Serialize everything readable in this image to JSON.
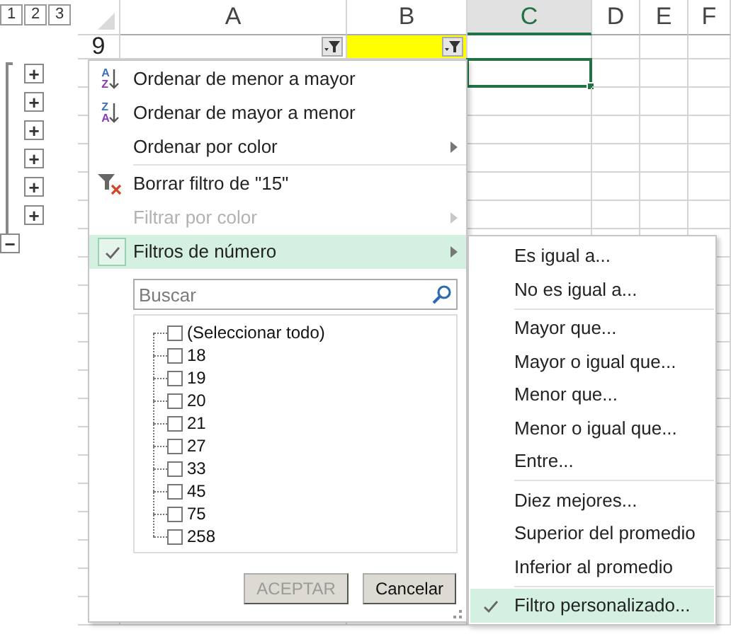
{
  "outline_levels": [
    "1",
    "2",
    "3"
  ],
  "columns": [
    {
      "label": "A",
      "selected": false
    },
    {
      "label": "B",
      "selected": false
    },
    {
      "label": "C",
      "selected": true
    },
    {
      "label": "D",
      "selected": false
    },
    {
      "label": "E",
      "selected": false
    },
    {
      "label": "F",
      "selected": false
    }
  ],
  "header_row": {
    "number": "9",
    "cells": [
      {
        "filter_button": true,
        "highlighted": false
      },
      {
        "filter_button": true,
        "highlighted": true
      }
    ]
  },
  "outline_buttons": [
    {
      "symbol": "+",
      "kind": "expand"
    },
    {
      "symbol": "+",
      "kind": "expand"
    },
    {
      "symbol": "+",
      "kind": "expand"
    },
    {
      "symbol": "+",
      "kind": "expand"
    },
    {
      "symbol": "+",
      "kind": "expand"
    },
    {
      "symbol": "+",
      "kind": "expand"
    },
    {
      "symbol": "−",
      "kind": "collapse"
    }
  ],
  "filter_menu": {
    "items": [
      {
        "kind": "sort",
        "label": "Ordenar de menor a mayor",
        "icon_letters": [
          "A",
          "Z"
        ],
        "disabled": false,
        "submenu": false,
        "checked": false,
        "selected": false
      },
      {
        "kind": "sort",
        "label": "Ordenar de mayor a menor",
        "icon_letters": [
          "Z",
          "A"
        ],
        "disabled": false,
        "submenu": false,
        "checked": false,
        "selected": false
      },
      {
        "kind": "item",
        "label": "Ordenar por color",
        "disabled": false,
        "submenu": true,
        "checked": false,
        "selected": false
      },
      {
        "kind": "separator"
      },
      {
        "kind": "clear_filter",
        "label": "Borrar filtro de \"15\"",
        "disabled": false,
        "submenu": false,
        "checked": false,
        "selected": false
      },
      {
        "kind": "item",
        "label": "Filtrar por color",
        "disabled": true,
        "submenu": true,
        "checked": false,
        "selected": false
      },
      {
        "kind": "item",
        "label": "Filtros de número",
        "disabled": false,
        "submenu": true,
        "checked": true,
        "selected": true
      }
    ],
    "search": {
      "placeholder": "Buscar"
    },
    "values": [
      {
        "label": "(Seleccionar todo)",
        "checked": false
      },
      {
        "label": "18",
        "checked": false
      },
      {
        "label": "19",
        "checked": false
      },
      {
        "label": "20",
        "checked": false
      },
      {
        "label": "21",
        "checked": false
      },
      {
        "label": "27",
        "checked": false
      },
      {
        "label": "33",
        "checked": false
      },
      {
        "label": "45",
        "checked": false
      },
      {
        "label": "75",
        "checked": false
      },
      {
        "label": "258",
        "checked": false
      }
    ],
    "buttons": [
      {
        "label": "ACEPTAR",
        "disabled": true
      },
      {
        "label": "Cancelar",
        "disabled": false
      }
    ]
  },
  "number_filters_submenu": [
    {
      "kind": "item",
      "label": "Es igual a...",
      "checked": false,
      "selected": false
    },
    {
      "kind": "item",
      "label": "No es igual a...",
      "checked": false,
      "selected": false
    },
    {
      "kind": "separator"
    },
    {
      "kind": "item",
      "label": "Mayor que...",
      "checked": false,
      "selected": false
    },
    {
      "kind": "item",
      "label": "Mayor o igual que...",
      "checked": false,
      "selected": false
    },
    {
      "kind": "item",
      "label": "Menor que...",
      "checked": false,
      "selected": false
    },
    {
      "kind": "item",
      "label": "Menor o igual que...",
      "checked": false,
      "selected": false
    },
    {
      "kind": "item",
      "label": "Entre...",
      "checked": false,
      "selected": false
    },
    {
      "kind": "separator"
    },
    {
      "kind": "item",
      "label": "Diez mejores...",
      "checked": false,
      "selected": false
    },
    {
      "kind": "item",
      "label": "Superior del promedio",
      "checked": false,
      "selected": false
    },
    {
      "kind": "item",
      "label": "Inferior al promedio",
      "checked": false,
      "selected": false
    },
    {
      "kind": "separator"
    },
    {
      "kind": "item",
      "label": "Filtro personalizado...",
      "checked": true,
      "selected": true
    }
  ]
}
